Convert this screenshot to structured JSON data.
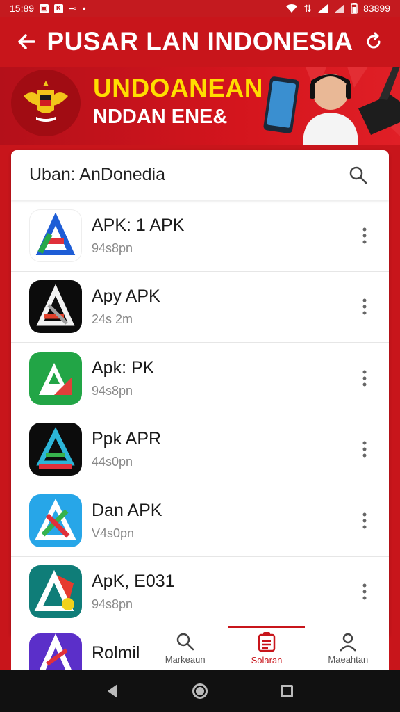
{
  "status_bar": {
    "time": "15:89",
    "battery": "83899"
  },
  "header": {
    "title": "PUSAR LAN INDONESIA"
  },
  "banner": {
    "line1": "UNDOANEAN",
    "line2": "NDDAN ENE&"
  },
  "search": {
    "value": "Uban: AnDonedia"
  },
  "apps": [
    {
      "name": "APK: 1 APK",
      "sub": "94s8pn",
      "icon": "apk-logo-icon",
      "bg": "#ffffff",
      "fg": "#1e5dd6"
    },
    {
      "name": "Apy APK",
      "sub": "24s 2m",
      "icon": "apk-logo-icon",
      "bg": "#0c0c0c",
      "fg": "#e0402a"
    },
    {
      "name": "Apk: PK",
      "sub": "94s8pn",
      "icon": "apk-logo-icon",
      "bg": "#22a546",
      "fg": "#ffffff"
    },
    {
      "name": "Ppk APR",
      "sub": "44s0pn",
      "icon": "apk-logo-icon",
      "bg": "#0c0c0c",
      "fg": "#2cb5d8"
    },
    {
      "name": "Dan APK",
      "sub": "V4s0pn",
      "icon": "apk-logo-icon",
      "bg": "#27a6e8",
      "fg": "#e0303a"
    },
    {
      "name": "ApK, E031",
      "sub": "94s8pn",
      "icon": "apk-logo-icon",
      "bg": "#0f7d78",
      "fg": "#e63b2e"
    }
  ],
  "partial_app": {
    "name": "Rolmil",
    "icon": "apk-logo-icon",
    "bg": "#5b2fc9"
  },
  "bottom_nav": [
    {
      "label": "Markeaun",
      "icon": "search-icon"
    },
    {
      "label": "Solaran",
      "icon": "list-doc-icon",
      "active": true
    },
    {
      "label": "Maeahtan",
      "icon": "person-icon"
    }
  ],
  "colors": {
    "primary": "#c8151b",
    "banner_accent": "#ffdd00"
  }
}
